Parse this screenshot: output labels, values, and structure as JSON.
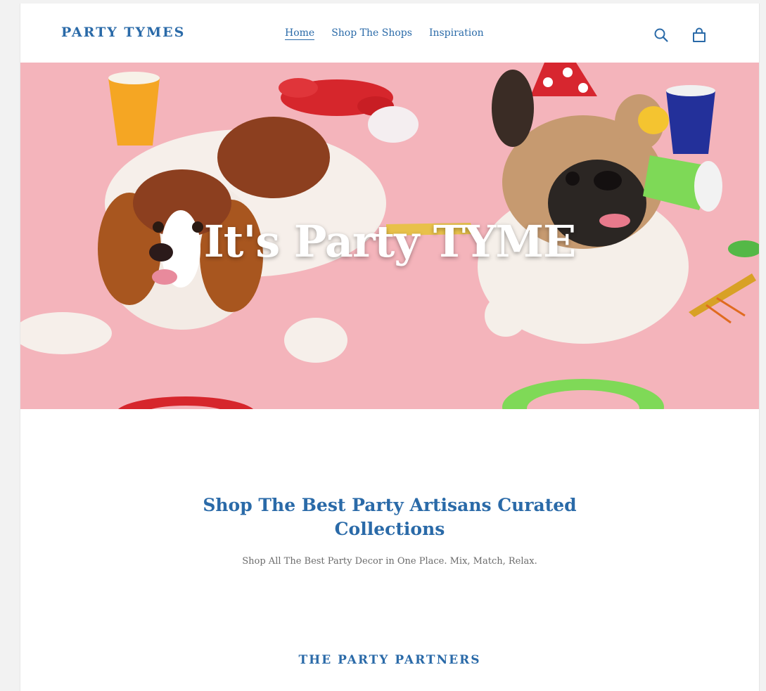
{
  "header": {
    "logo": "PARTY TYMES",
    "nav": [
      {
        "label": "Home",
        "active": true
      },
      {
        "label": "Shop The Shops",
        "active": false
      },
      {
        "label": "Inspiration",
        "active": false
      }
    ],
    "icons": [
      "search-icon",
      "cart-icon"
    ]
  },
  "hero": {
    "title": "It's Party TYME",
    "image": "two dogs at a party on pink background"
  },
  "collection": {
    "title_line1": "Shop The Best Party Artisans Curated",
    "title_line2": "Collections",
    "subtitle": "Shop All The Best Party Decor in One Place. Mix, Match, Relax."
  },
  "partners": {
    "heading": "THE PARTY PARTNERS"
  },
  "colors": {
    "brand": "#2a6aa8",
    "hero_background": "#f4b4bb",
    "body_text": "#6b6b6b"
  }
}
